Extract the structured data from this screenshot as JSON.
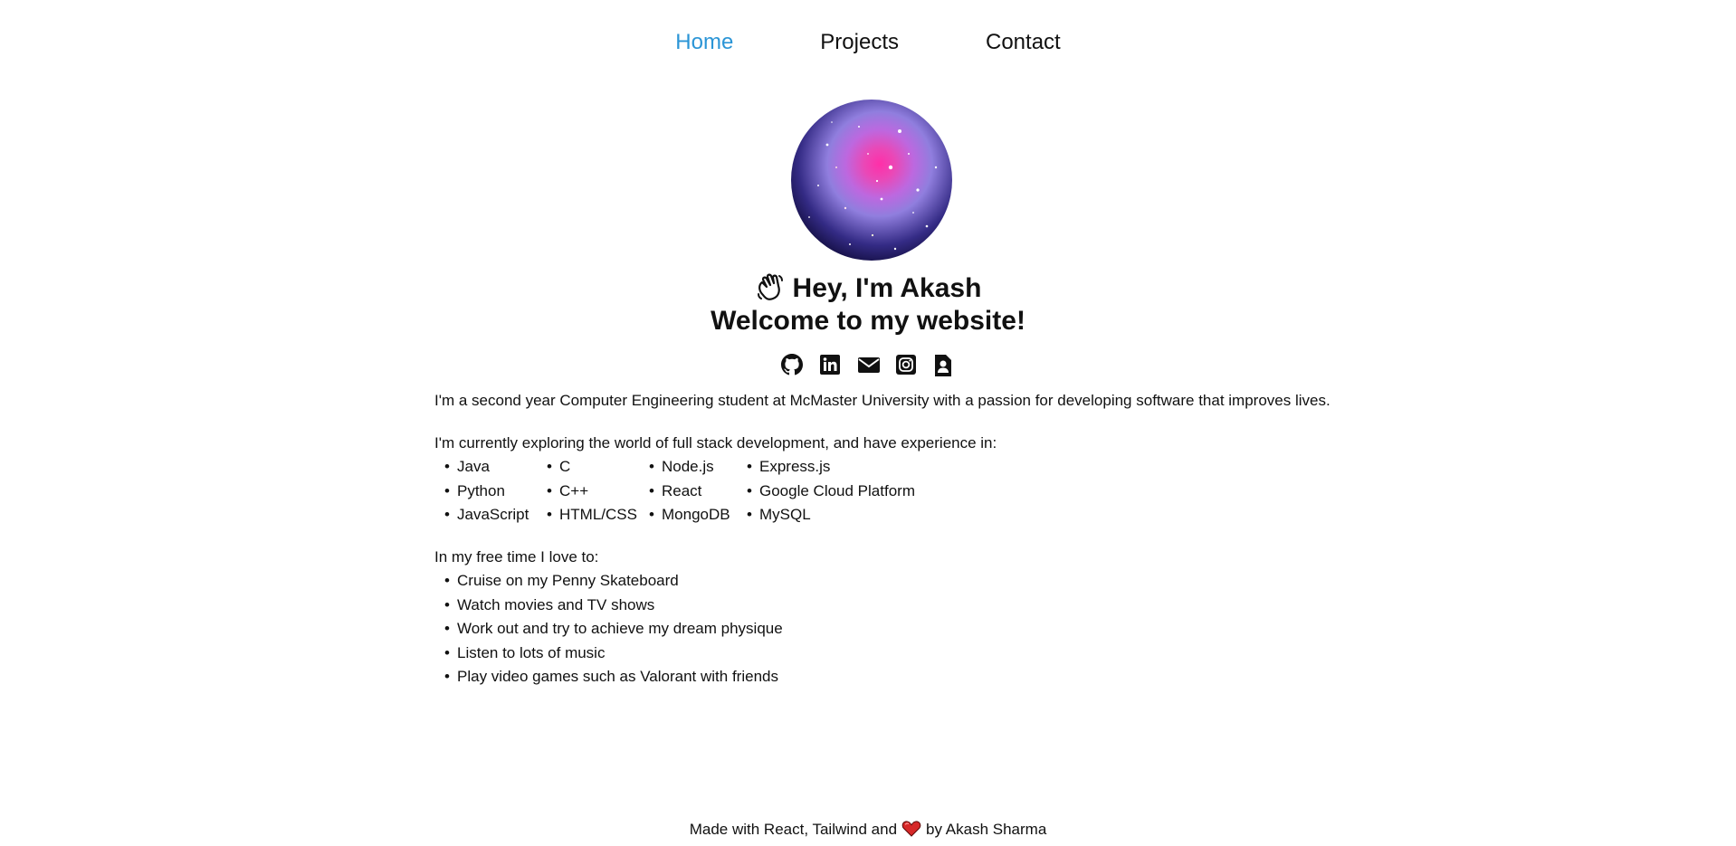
{
  "nav": {
    "items": [
      {
        "label": "Home",
        "active": true
      },
      {
        "label": "Projects",
        "active": false
      },
      {
        "label": "Contact",
        "active": false
      }
    ],
    "active_color": "#2b95d6"
  },
  "hero": {
    "greeting": "Hey, I'm Akash",
    "welcome": "Welcome to my website!",
    "wave_icon": "waving-hand-icon"
  },
  "socials": [
    {
      "icon": "github-icon"
    },
    {
      "icon": "linkedin-icon"
    },
    {
      "icon": "email-icon"
    },
    {
      "icon": "instagram-icon"
    },
    {
      "icon": "resume-icon"
    }
  ],
  "about": {
    "intro": "I'm a second year Computer Engineering student at McMaster University with a passion for developing software that improves lives.",
    "skills_heading": "I'm currently exploring the world of full stack development, and have experience in:",
    "skills_columns": [
      [
        "Java",
        "Python",
        "JavaScript"
      ],
      [
        "C",
        "C++",
        "HTML/CSS"
      ],
      [
        "Node.js",
        "React",
        "MongoDB"
      ],
      [
        "Express.js",
        "Google Cloud Platform",
        "MySQL"
      ]
    ],
    "free_time_heading": "In my free time I love to:",
    "hobbies": [
      "Cruise on my Penny Skateboard",
      "Watch movies and TV shows",
      "Work out and try to achieve my dream physique",
      "Listen to lots of music",
      "Play video games such as Valorant with friends"
    ]
  },
  "footer": {
    "before": "Made with React, Tailwind and",
    "after": "by Akash Sharma",
    "heart_icon": "heart-icon",
    "heart_color": "#d62828"
  }
}
